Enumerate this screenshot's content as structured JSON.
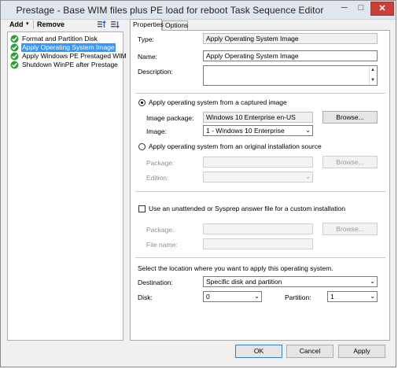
{
  "window": {
    "title": "Prestage - Base WIM files plus PE load for reboot Task Sequence Editor",
    "minimize_glyph": "─",
    "maximize_glyph": "□",
    "close_glyph": "✕"
  },
  "toolbar": {
    "add_label": "Add",
    "add_caret": "▾",
    "remove_label": "Remove",
    "icons": [
      "move-up-icon",
      "move-down-icon"
    ]
  },
  "tree": {
    "items": [
      {
        "label": "Format and Partition Disk",
        "selected": false,
        "icon": "green-check-icon"
      },
      {
        "label": "Apply Operating System Image",
        "selected": true,
        "icon": "green-check-icon"
      },
      {
        "label": "Apply Windows PE Prestaged WIM",
        "selected": false,
        "icon": "green-check-icon"
      },
      {
        "label": "Shutdown WinPE after Prestage",
        "selected": false,
        "icon": "green-check-icon"
      }
    ]
  },
  "tabs": [
    {
      "label": "Properties",
      "active": true
    },
    {
      "label": "Options",
      "active": false
    }
  ],
  "props": {
    "type_label": "Type:",
    "type_value": "Apply Operating System Image",
    "name_label": "Name:",
    "name_value": "Apply Operating System Image",
    "description_label": "Description:",
    "description_value": "",
    "scroll_up": "▲",
    "scroll_down": "▼"
  },
  "captured": {
    "radio_label": "Apply operating system from a captured image",
    "selected": true,
    "package_label": "Image package:",
    "package_value": "Windows 10 Enterprise  en-US",
    "browse_label": "Browse...",
    "image_label": "Image:",
    "image_value": "1 - Windows 10 Enterprise"
  },
  "original": {
    "radio_label": "Apply operating system from an original installation source",
    "selected": false,
    "package_label": "Package:",
    "package_value": "",
    "browse_label": "Browse...",
    "edition_label": "Edition:",
    "edition_value": ""
  },
  "answer": {
    "checkbox_label": "Use an unattended or Sysprep answer file for a custom installation",
    "checked": false,
    "package_label": "Package:",
    "package_value": "",
    "browse_label": "Browse...",
    "filename_label": "File name:",
    "filename_value": ""
  },
  "location": {
    "prompt": "Select the location where you want to apply this operating system.",
    "destination_label": "Destination:",
    "destination_value": "Specific disk and partition",
    "disk_label": "Disk:",
    "disk_value": "0",
    "partition_label": "Partition:",
    "partition_value": "1"
  },
  "combo_arrow": "⌄",
  "footer": {
    "ok_label": "OK",
    "cancel_label": "Cancel",
    "apply_label": "Apply"
  },
  "colors": {
    "selection": "#3399ff",
    "check_green": "#2e9e3a",
    "close_red": "#c7413a"
  }
}
